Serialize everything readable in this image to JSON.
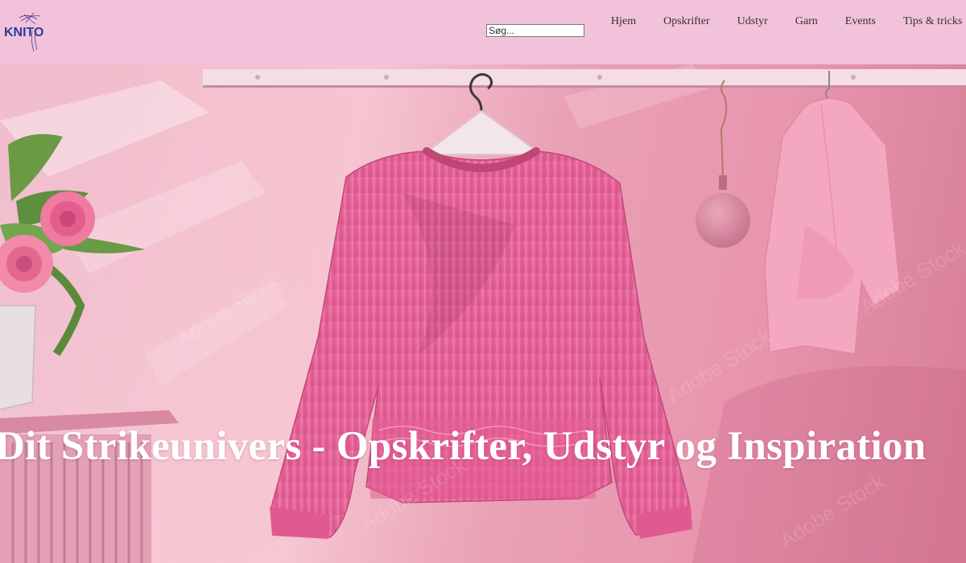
{
  "header": {
    "logo_text": "KNITO",
    "search": {
      "placeholder": "Søg...",
      "value": ""
    },
    "nav": [
      {
        "label": "Hjem"
      },
      {
        "label": "Opskrifter"
      },
      {
        "label": "Udstyr"
      },
      {
        "label": "Garn"
      },
      {
        "label": "Events"
      },
      {
        "label": "Tips & tricks"
      }
    ]
  },
  "hero": {
    "title": "Dit Strikeunivers - Opskrifter, Udstyr og Inspiration",
    "watermark_text": "Adobe Stock"
  },
  "colors": {
    "header_bg": "#f2c2da",
    "sweater": "#ec6c9e",
    "logo_blue": "#2a3a9a",
    "title": "#ffffff"
  }
}
